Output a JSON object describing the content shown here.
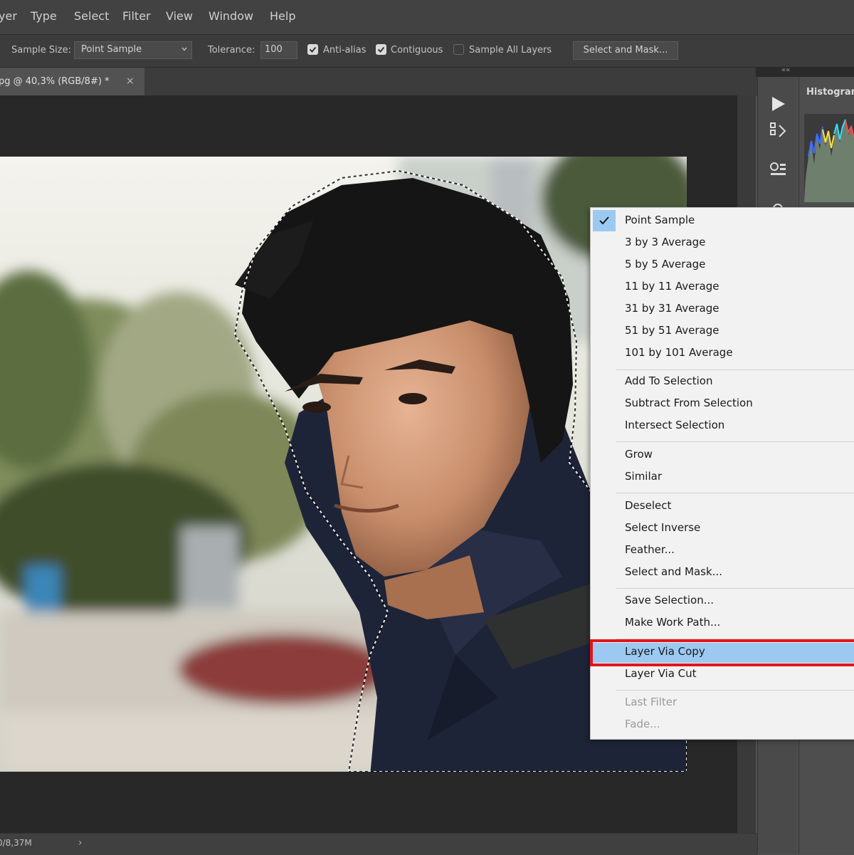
{
  "menubar": {
    "items": [
      "yer",
      "Type",
      "Select",
      "Filter",
      "View",
      "Window",
      "Help"
    ]
  },
  "options": {
    "sample_size_label": "Sample Size:",
    "sample_size_value": "Point Sample",
    "tolerance_label": "Tolerance:",
    "tolerance_value": "100",
    "anti_alias_label": "Anti-alias",
    "anti_alias_checked": true,
    "contiguous_label": "Contiguous",
    "contiguous_checked": true,
    "sample_all_layers_label": "Sample All Layers",
    "sample_all_layers_checked": false,
    "select_mask_button": "Select and Mask..."
  },
  "document": {
    "tab_title": "pg @ 40,3% (RGB/8#) *",
    "close_glyph": "×"
  },
  "status": {
    "doc_size": "0/8,37M",
    "arrow": "›"
  },
  "panels": {
    "collapse_glyph": "««",
    "histogram_title": "Histogram",
    "dock_icons": [
      "play-icon",
      "history-icon",
      "properties-icon",
      "adjustments-icon"
    ]
  },
  "context_menu": {
    "sections": [
      [
        {
          "label": "Point Sample",
          "checked": true
        },
        {
          "label": "3 by 3 Average"
        },
        {
          "label": "5 by 5 Average"
        },
        {
          "label": "11 by 11 Average"
        },
        {
          "label": "31 by 31 Average"
        },
        {
          "label": "51 by 51 Average"
        },
        {
          "label": "101 by 101 Average"
        }
      ],
      [
        {
          "label": "Add To Selection"
        },
        {
          "label": "Subtract From Selection"
        },
        {
          "label": "Intersect Selection"
        }
      ],
      [
        {
          "label": "Grow"
        },
        {
          "label": "Similar"
        }
      ],
      [
        {
          "label": "Deselect"
        },
        {
          "label": "Select Inverse"
        },
        {
          "label": "Feather..."
        },
        {
          "label": "Select and Mask..."
        }
      ],
      [
        {
          "label": "Save Selection..."
        },
        {
          "label": "Make Work Path..."
        }
      ],
      [
        {
          "label": "Layer Via Copy",
          "highlighted": true
        },
        {
          "label": "Layer Via Cut"
        }
      ],
      [
        {
          "label": "Last Filter",
          "disabled": true
        },
        {
          "label": "Fade...",
          "disabled": true
        }
      ]
    ]
  },
  "colors": {
    "highlight": "#9bc9f2",
    "annotation_outline": "#e0161c",
    "menu_bg": "#f2f2f2"
  }
}
